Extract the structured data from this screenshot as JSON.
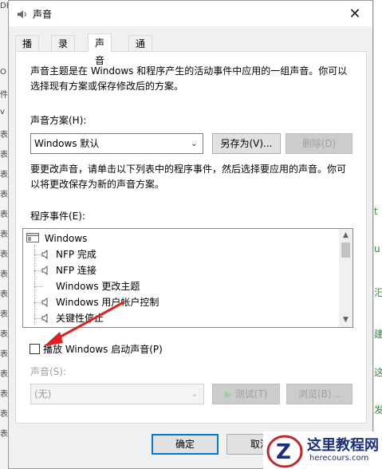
{
  "window": {
    "title": "声音",
    "close_glyph": "✕"
  },
  "tabs": [
    {
      "label": "播放"
    },
    {
      "label": "录制"
    },
    {
      "label": "声音"
    },
    {
      "label": "通信"
    }
  ],
  "sounds": {
    "description": "声音主题是在 Windows 和程序产生的活动事件中应用的一组声音。你可以选择现有方案或保存修改后的方案。",
    "scheme_label": "声音方案(H):",
    "scheme_value": "Windows 默认",
    "save_as_label": "另存为(V)...",
    "delete_label": "删除(D)",
    "change_description": "要更改声音，请单击以下列表中的程序事件，然后选择要应用的声音。你可以将更改保存为新的声音方案。",
    "events_label": "程序事件(E):",
    "events": [
      {
        "label": "Windows",
        "icon": "window-icon"
      },
      {
        "label": "NFP 完成",
        "icon": "speaker-icon"
      },
      {
        "label": "NFP 连接",
        "icon": "speaker-icon"
      },
      {
        "label": "Windows 更改主题",
        "icon": ""
      },
      {
        "label": "Windows 用户帐户控制",
        "icon": "speaker-icon"
      },
      {
        "label": "关键性停止",
        "icon": "speaker-icon"
      }
    ],
    "startup_checkbox_label": "播放 Windows 启动声音(P)",
    "startup_checked": false,
    "sound_label": "声音(S):",
    "sound_value": "(无)",
    "test_label": "测试(T)",
    "browse_label": "浏览(B)..."
  },
  "footer": {
    "ok_label": "确定",
    "cancel_label": "取消"
  },
  "background": {
    "left_fragments": [
      "DE",
      "O",
      "件",
      "v",
      "表",
      "表",
      "表",
      "表",
      "表",
      "表",
      "表",
      "表",
      "表",
      "表",
      "表",
      "表",
      "表",
      "表",
      "表",
      "表"
    ],
    "right_fragments": [
      "t",
      "u",
      "汜",
      "建",
      "这",
      "发"
    ]
  },
  "watermark": {
    "title": "这里教程网",
    "url": "herecours.com"
  },
  "colors": {
    "accent": "#0078d7",
    "annotation_arrow": "#e02020",
    "watermark": "#1c2f7a"
  }
}
